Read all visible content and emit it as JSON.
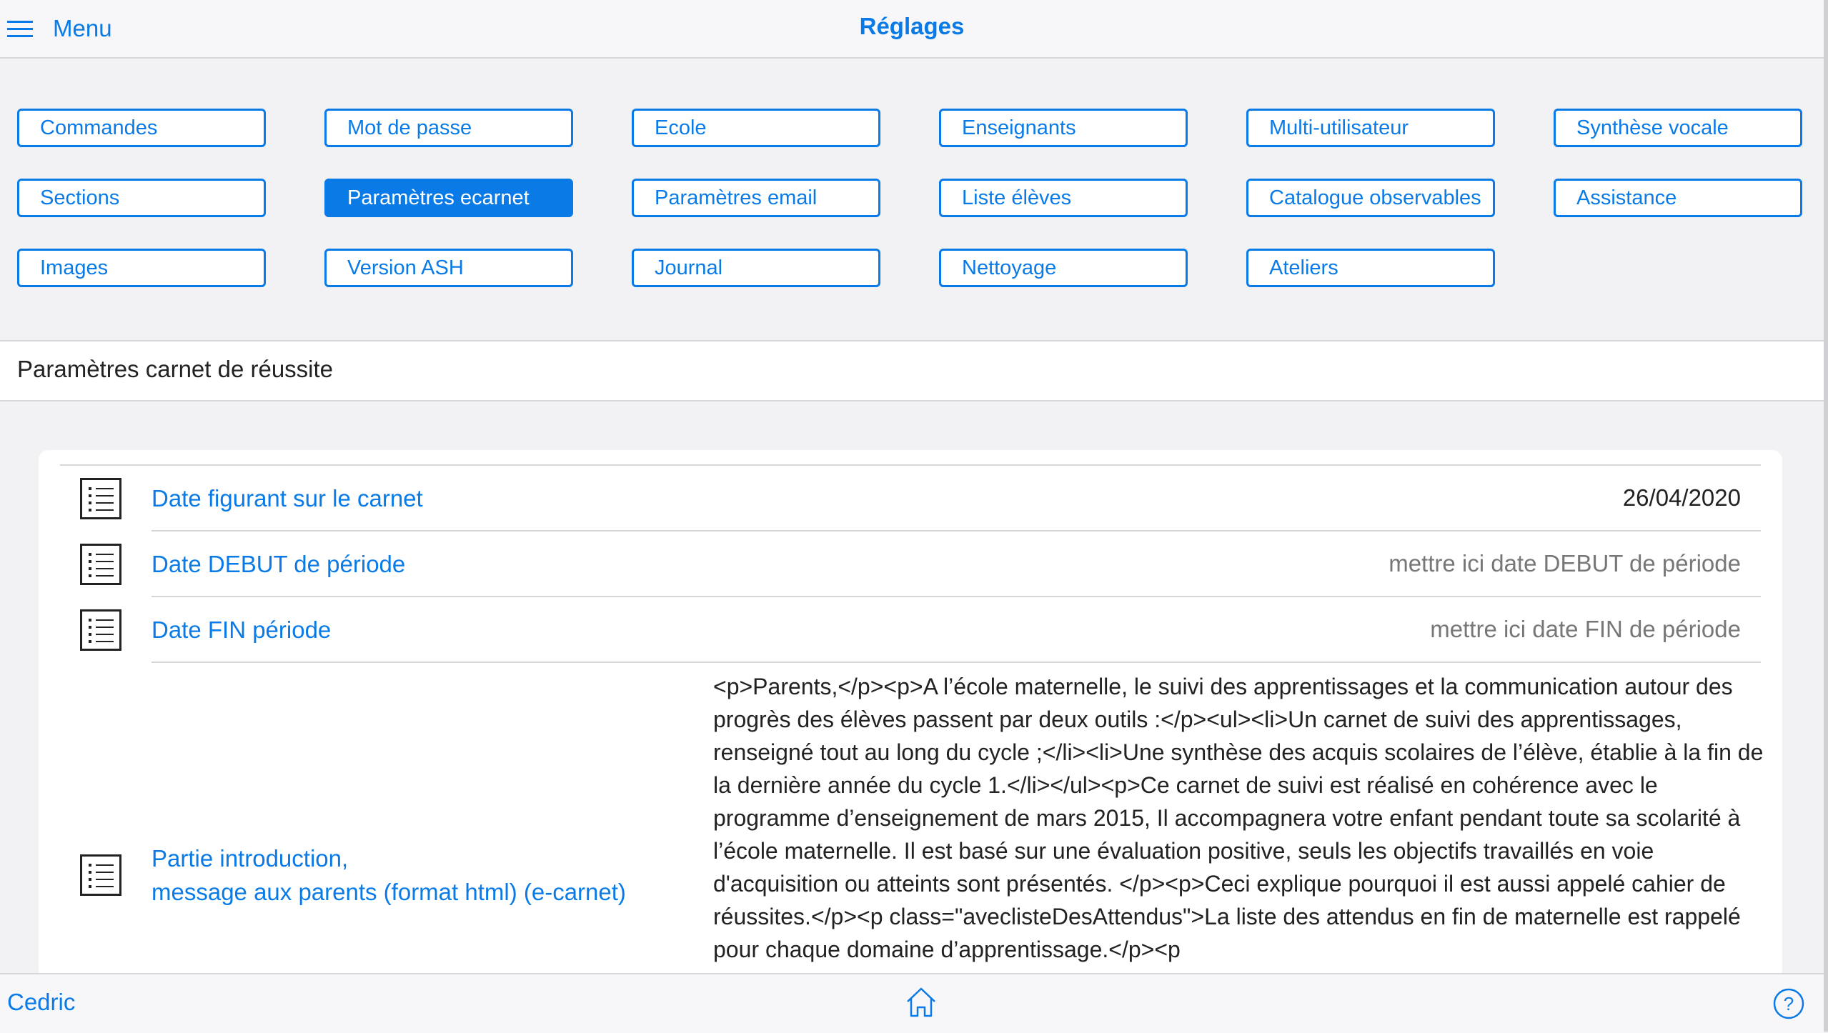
{
  "topbar": {
    "menu_label": "Menu",
    "title": "Réglages"
  },
  "buttons": [
    [
      "Commandes",
      "Mot de passe",
      "Ecole",
      "Enseignants",
      "Multi-utilisateur",
      "Synthèse vocale"
    ],
    [
      "Sections",
      "Paramètres ecarnet",
      "Paramètres email",
      "Liste élèves",
      "Catalogue observables",
      "Assistance"
    ],
    [
      "Images",
      "Version ASH",
      "Journal",
      "Nettoyage",
      "Ateliers"
    ]
  ],
  "active_button": "Paramètres ecarnet",
  "section": {
    "title": "Paramètres carnet de réussite"
  },
  "settings": {
    "date_carnet": {
      "label": "Date figurant sur le carnet",
      "value": "26/04/2020"
    },
    "date_debut": {
      "label": "Date DEBUT de période",
      "value": "mettre ici date DEBUT de  période"
    },
    "date_fin": {
      "label": "Date FIN période",
      "value": "mettre ici date FIN de période"
    },
    "introduction": {
      "label_line1": "Partie introduction,",
      "label_line2": "message aux parents (format html) (e-carnet)",
      "value": "<p>Parents,</p><p>A l’école maternelle, le suivi des apprentissages et la communication autour des progrès des élèves passent par deux outils :</p><ul><li>Un carnet de suivi des apprentissages, renseigné tout au long du cycle ;</li><li>Une synthèse des acquis scolaires de l’élève, établie à la fin de la dernière année du cycle 1.</li></ul><p>Ce carnet de suivi est réalisé en cohérence avec le programme d’enseignement de mars 2015, Il accompagnera votre enfant pendant toute sa scolarité à l’école maternelle. Il est basé sur une évaluation positive, seuls les objectifs travaillés en voie d'acquisition ou atteints sont présentés. </p><p>Ceci explique pourquoi il est aussi appelé cahier de réussites.</p><p class=\"aveclisteDesAttendus\">La liste des attendus en fin de maternelle est rappelé pour chaque domaine d’apprentissage.</p><p"
    }
  },
  "bottombar": {
    "user": "Cedric"
  },
  "colors": {
    "accent": "#0a7be6",
    "background": "#f2f2f4"
  }
}
